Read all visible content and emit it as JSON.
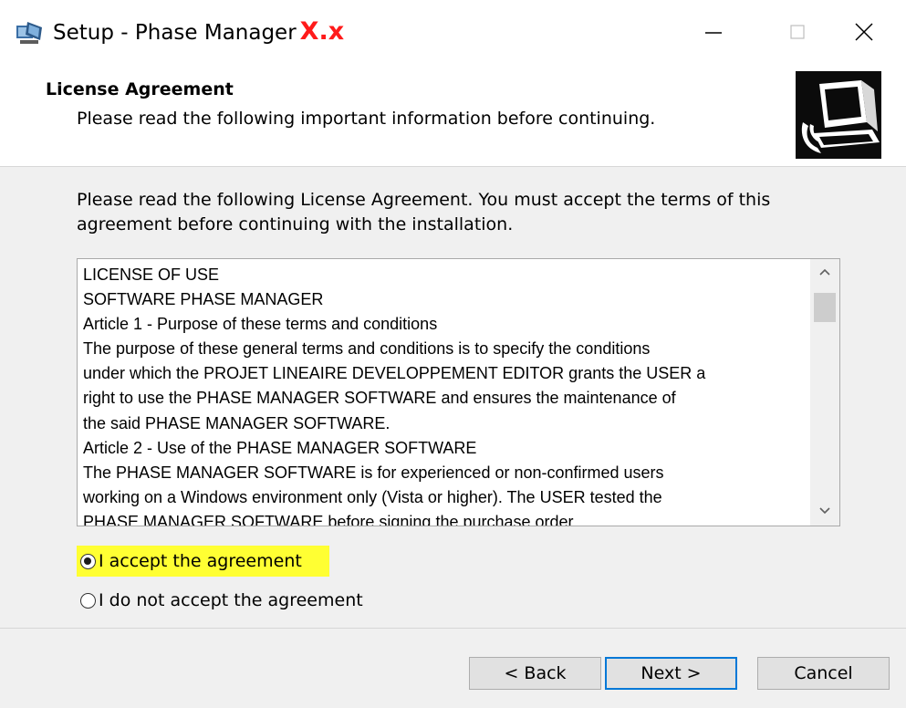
{
  "window": {
    "title": "Setup - Phase Manager",
    "title_version": "X.x",
    "title_version_color": "#ff1a1a",
    "controls": {
      "minimize": "minimize-icon",
      "maximize": "maximize-icon",
      "close": "close-icon"
    }
  },
  "header": {
    "title": "License Agreement",
    "subtitle": "Please read the following important information before continuing.",
    "logo_icon": "setup-computer-icon"
  },
  "body": {
    "intro": "Please read the following License Agreement. You must accept the terms of this agreement before continuing with the installation.",
    "license_lines": [
      "LICENSE OF USE",
      "SOFTWARE PHASE MANAGER",
      "Article 1 - Purpose of these terms and conditions",
      "The purpose of these general terms and conditions is to specify the conditions",
      "under which the PROJET LINEAIRE DEVELOPPEMENT EDITOR grants the USER a",
      "right to use the PHASE MANAGER SOFTWARE and ensures the maintenance of",
      "the said PHASE MANAGER SOFTWARE.",
      "Article 2 - Use of the PHASE MANAGER SOFTWARE",
      "The PHASE MANAGER SOFTWARE is for experienced or non-confirmed users",
      "working on a Windows environment only (Vista or higher). The USER tested the",
      "PHASE MANAGER SOFTWARE before signing the purchase order."
    ],
    "scroll_up": "^",
    "scroll_down": "v",
    "options": {
      "accept": "I accept the agreement",
      "decline": "I do not accept the agreement",
      "selected": "accept",
      "highlight_color": "#ffff33"
    }
  },
  "footer": {
    "back": "< Back",
    "next": "Next >",
    "cancel": "Cancel",
    "accent": "#0078d7"
  }
}
